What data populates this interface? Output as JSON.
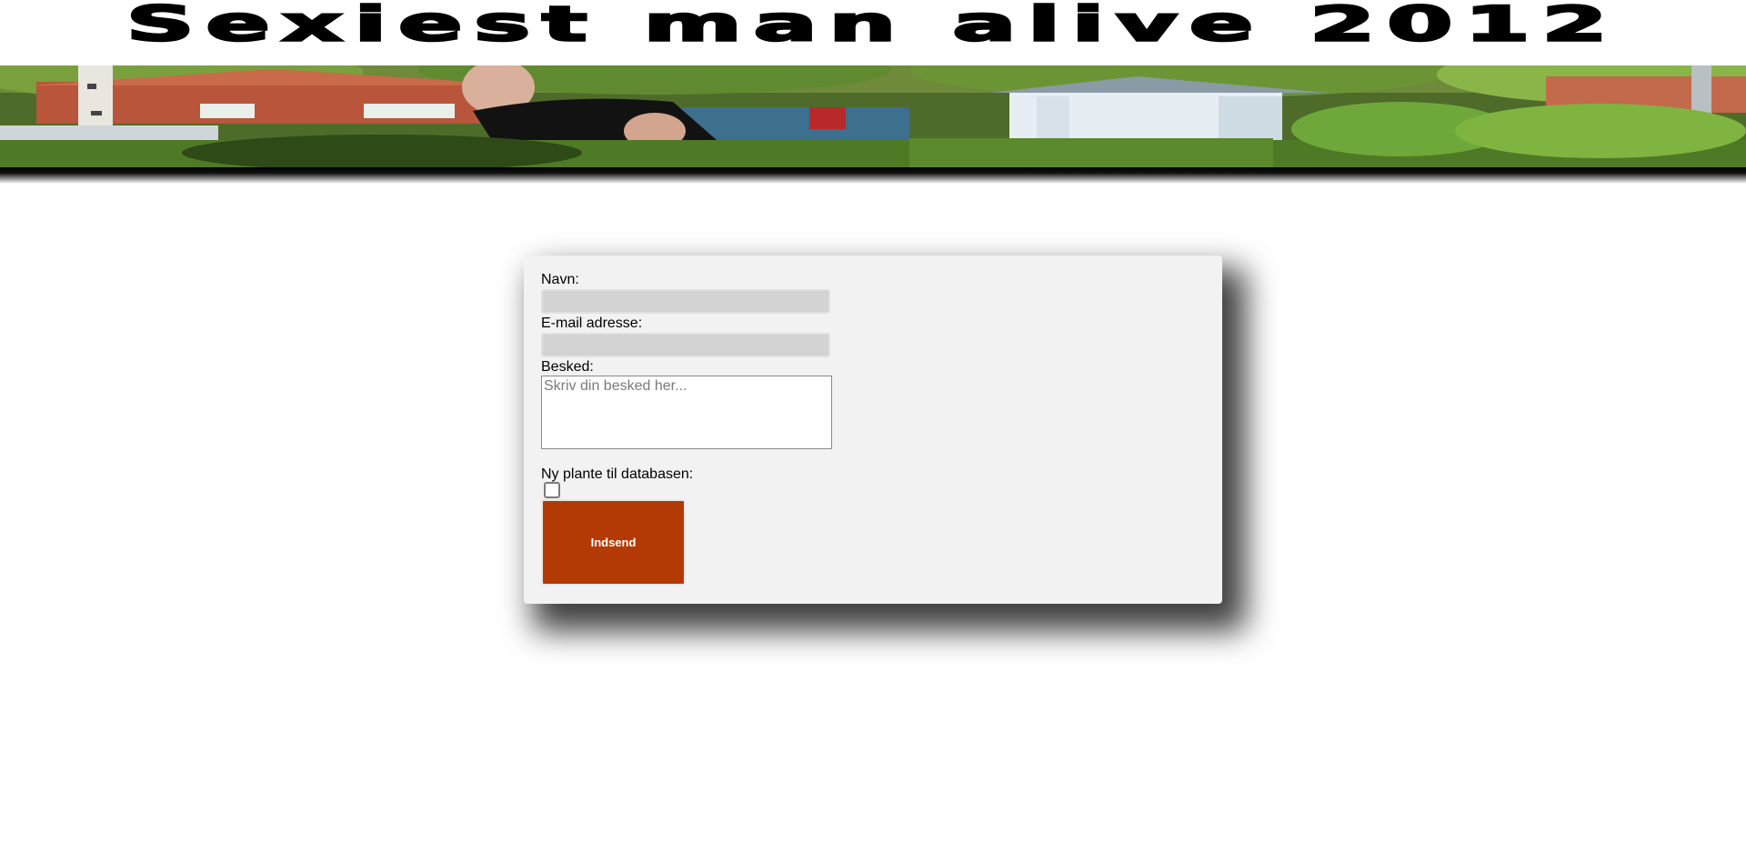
{
  "header": {
    "title": "Sexiest man alive 2012"
  },
  "banner": {
    "icon": "garden-photo-banner"
  },
  "form": {
    "name_label": "Navn:",
    "name_value": "",
    "email_label": "E-mail adresse:",
    "email_value": "",
    "message_label": "Besked:",
    "message_placeholder": "Skriv din besked her...",
    "message_value": "",
    "checkbox_label": "Ny plante til databasen:",
    "checkbox_checked": false,
    "submit_label": "Indsend"
  },
  "colors": {
    "button": "#b33a05",
    "card": "#f2f2f2",
    "input_bg": "#d3d3d3"
  }
}
